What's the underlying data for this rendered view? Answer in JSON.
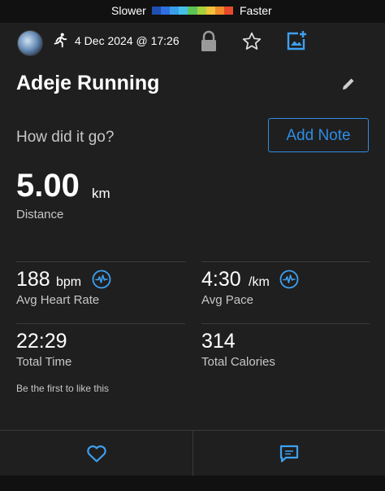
{
  "legend": {
    "slower_label": "Slower",
    "faster_label": "Faster",
    "colors": [
      "#1f4fb0",
      "#2f6fe0",
      "#3a9de8",
      "#44c0e8",
      "#5cc456",
      "#a6d13c",
      "#f2c23a",
      "#f08a2c",
      "#e64a2a"
    ]
  },
  "activity": {
    "date": "4 Dec 2024 @ 17:26",
    "title": "Adeje Running",
    "prompt": "How did it go?",
    "add_note_label": "Add Note"
  },
  "distance": {
    "value": "5.00",
    "unit": "km",
    "label": "Distance"
  },
  "stats": {
    "heart_rate": {
      "value": "188",
      "unit": "bpm",
      "label": "Avg Heart Rate"
    },
    "pace": {
      "value": "4:30",
      "unit": "/km",
      "label": "Avg Pace"
    },
    "time": {
      "value": "22:29",
      "label": "Total Time"
    },
    "calories": {
      "value": "314",
      "label": "Total Calories"
    }
  },
  "social": {
    "likes_text": "Be the first to like this"
  },
  "colors": {
    "accent": "#2f8de4",
    "card_bg": "#1f1f1f",
    "page_bg": "#111111",
    "muted_text": "#c7c7c7"
  },
  "icons": {
    "activity_type": "running-icon",
    "privacy": "lock-icon",
    "favorite": "star-icon",
    "add_photo": "add-photo-icon",
    "edit": "pencil-icon",
    "stat_detail": "pulse-icon",
    "like": "heart-icon",
    "comment": "comment-icon"
  }
}
